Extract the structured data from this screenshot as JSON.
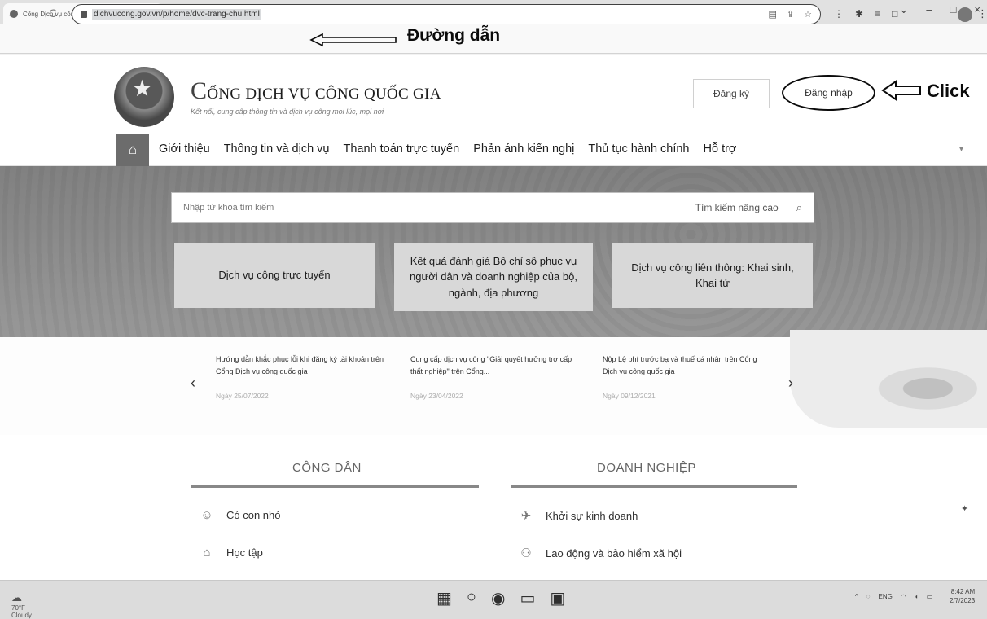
{
  "browser": {
    "tab_title": "Cổng Dịch vụ công Quốc gia",
    "tab_close": "×",
    "new_tab": "+",
    "url": "dichvucong.gov.vn/p/home/dvc-trang-chu.html",
    "window_controls": [
      "⌄",
      "–",
      "□",
      "×"
    ]
  },
  "annotations": {
    "url_label": "Đường dẫn",
    "click_label": "Click"
  },
  "header": {
    "title_first_letter": "C",
    "title_rest": "ỔNG DỊCH VỤ CÔNG QUỐC GIA",
    "tagline": "Kết nối, cung cấp thông tin và dịch vụ công mọi lúc, mọi nơi",
    "register_label": "Đăng ký",
    "login_label": "Đăng nhập"
  },
  "nav": {
    "home_icon": "home-icon",
    "items": [
      "Giới thiệu",
      "Thông tin và dịch vụ",
      "Thanh toán trực tuyến",
      "Phản ánh kiến nghị",
      "Thủ tục hành chính",
      "Hỗ trợ"
    ]
  },
  "search": {
    "placeholder": "Nhập từ khoá tìm kiếm",
    "advanced_label": "Tìm kiếm nâng cao"
  },
  "hero_cards": [
    "Dịch vụ công trực tuyến",
    "Kết quả đánh giá Bộ chỉ số phục vụ người dân và doanh nghiệp của bộ, ngành, địa phương",
    "Dịch vụ công liên thông: Khai sinh, Khai tử"
  ],
  "news": [
    {
      "title": "Hướng dẫn khắc phục lỗi khi đăng ký tài khoản trên Cổng Dịch vụ công quốc gia",
      "date": "Ngày 25/07/2022"
    },
    {
      "title": "Cung cấp dịch vụ công \"Giải quyết hưởng trợ cấp thất nghiệp\" trên Cổng...",
      "date": "Ngày 23/04/2022"
    },
    {
      "title": "Nộp Lệ phí trước bạ và thuế cá nhân trên Cổng Dịch vụ công quốc gia",
      "date": "Ngày 09/12/2021"
    }
  ],
  "sections": {
    "citizen": {
      "title": "CÔNG DÂN",
      "items": [
        "Có con nhỏ",
        "Học tập"
      ]
    },
    "business": {
      "title": "DOANH NGHIỆP",
      "items": [
        "Khởi sự kinh doanh",
        "Lao động và bảo hiểm xã hội"
      ]
    }
  },
  "taskbar": {
    "temp": "70°F",
    "weather": "Cloudy",
    "lang": "ENG",
    "time": "8:42 AM",
    "date": "2/7/2023"
  }
}
